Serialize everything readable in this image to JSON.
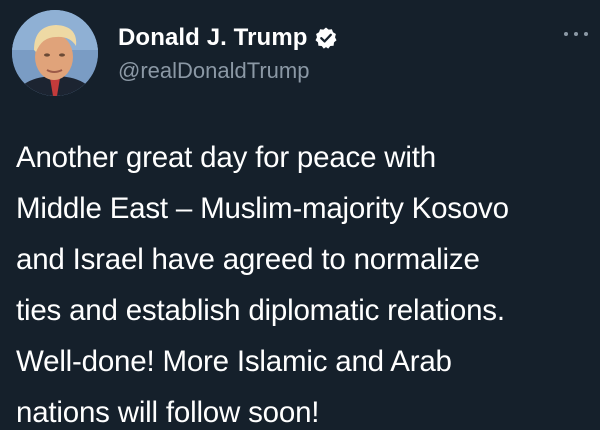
{
  "author": {
    "display_name": "Donald J. Trump",
    "handle": "@realDonaldTrump",
    "verified": true,
    "avatar_icon": "profile-photo"
  },
  "tweet": {
    "lines": [
      "Another great day for peace with",
      "Middle East – Muslim-majority Kosovo",
      "and Israel have agreed to normalize",
      "ties and establish diplomatic relations.",
      "Well-done! More Islamic and Arab",
      "nations will follow soon!"
    ]
  },
  "icons": {
    "verified": "verified-badge-icon",
    "more": "more-options-icon"
  },
  "colors": {
    "background": "#15202b",
    "primary_text": "#ffffff",
    "secondary_text": "#8b98a5",
    "verified_badge": "#ffffff"
  }
}
